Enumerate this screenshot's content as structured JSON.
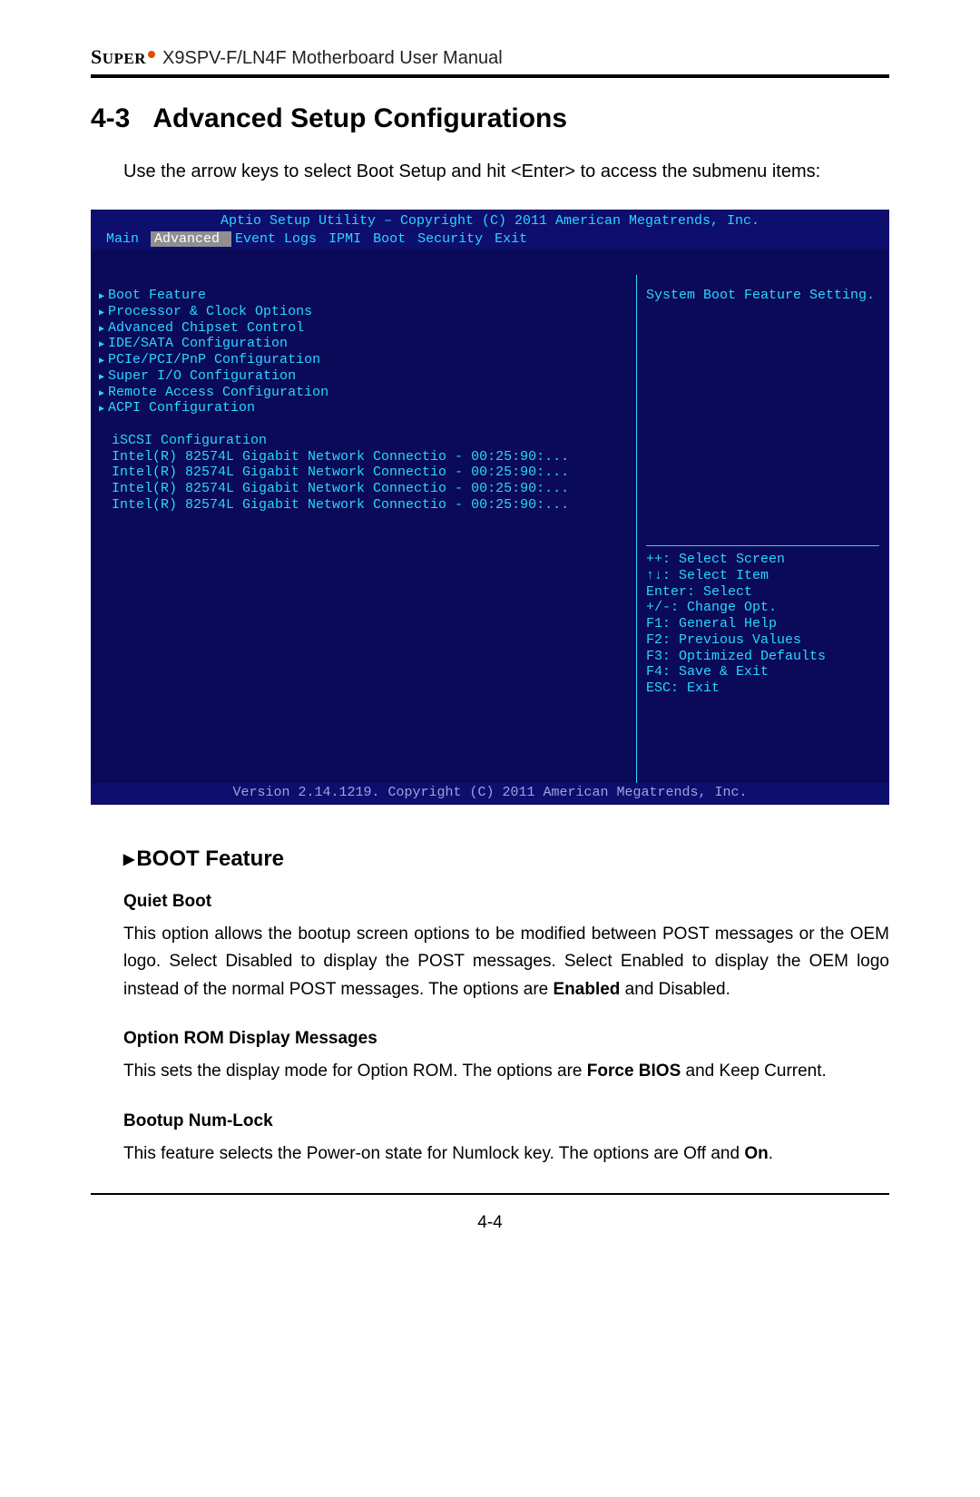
{
  "header": {
    "brand_main": "S",
    "brand_rest": "UPER",
    "doc_title": "X9SPV-F/LN4F Motherboard User Manual"
  },
  "section": {
    "number": "4-3",
    "title": "Advanced Setup Configurations",
    "intro": "Use the arrow keys to select Boot Setup and hit <Enter> to access the submenu items:"
  },
  "bios": {
    "title": "Aptio Setup Utility – Copyright (C) 2011 American Megatrends, Inc.",
    "menu": [
      "Main",
      "Advanced",
      "Event Logs",
      "IPMI",
      "Boot",
      "Security",
      "Exit"
    ],
    "selected_menu_index": 1,
    "submenus": [
      "Boot Feature",
      "Processor & Clock Options",
      "Advanced Chipset Control",
      "IDE/SATA Configuration",
      "PCIe/PCI/PnP Configuration",
      "Super I/O Configuration",
      "Remote Access Configuration",
      "ACPI Configuration"
    ],
    "plain_items": [
      "iSCSI Configuration",
      "Intel(R) 82574L Gigabit Network Connectio - 00:25:90:...",
      "Intel(R) 82574L Gigabit Network Connectio - 00:25:90:...",
      "Intel(R) 82574L Gigabit Network Connectio - 00:25:90:...",
      "Intel(R) 82574L Gigabit Network Connectio - 00:25:90:..."
    ],
    "right_desc": "System Boot Feature Setting.",
    "help": [
      "++: Select Screen",
      "↑↓: Select Item",
      "Enter: Select",
      "+/-: Change Opt.",
      "F1: General Help",
      "F2: Previous Values",
      "F3: Optimized Defaults",
      "F4: Save & Exit",
      "ESC: Exit"
    ],
    "footer": "Version 2.14.1219. Copyright (C) 2011 American Megatrends, Inc."
  },
  "boot_feature": {
    "heading": "BOOT Feature",
    "items": [
      {
        "title": "Quiet Boot",
        "body_html": "This option allows the bootup screen options to be modified between POST messages or the OEM logo. Select Disabled to display the POST messages. Select Enabled to display the OEM logo instead of the normal POST messages. The options are <b>Enabled</b> and Disabled."
      },
      {
        "title": "Option ROM Display Messages",
        "body_html": "This sets the display mode for Option ROM. The options are <b>Force BIOS</b> and Keep Current."
      },
      {
        "title": "Bootup Num-Lock",
        "body_html": "This feature selects the Power-on state for Numlock key. The options are Off and <b>On</b>."
      }
    ]
  },
  "page_number": "4-4"
}
